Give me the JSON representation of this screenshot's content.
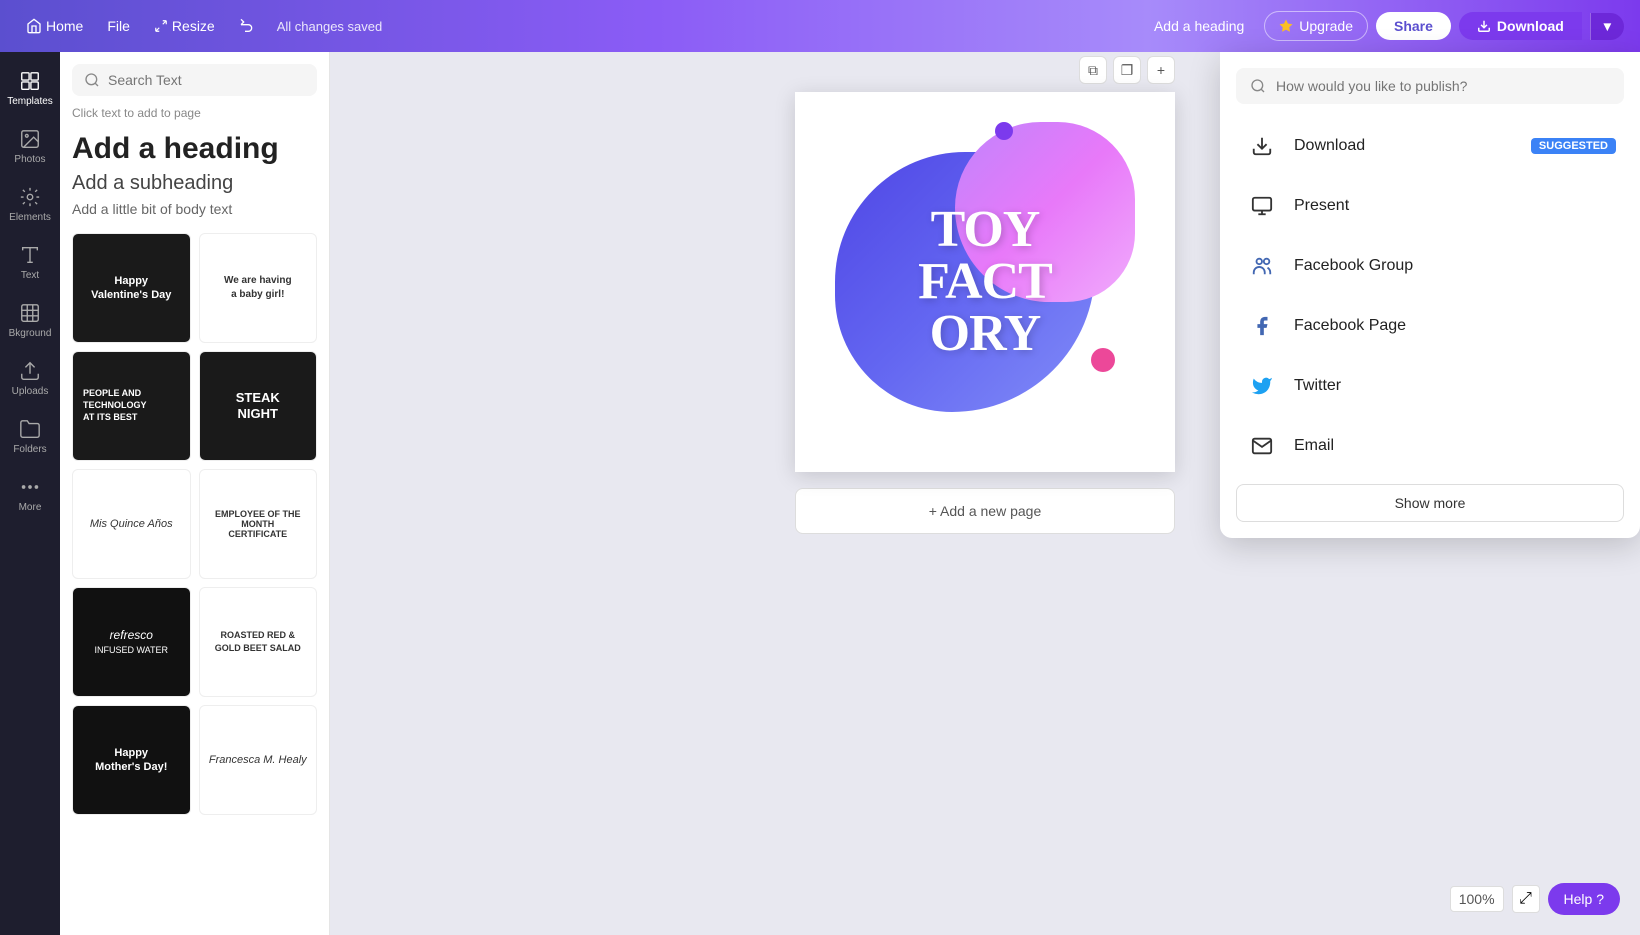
{
  "topnav": {
    "home_label": "Home",
    "file_label": "File",
    "resize_label": "Resize",
    "saved_text": "All changes saved",
    "add_heading_label": "Add a heading",
    "upgrade_label": "Upgrade",
    "share_label": "Share",
    "download_label": "Download"
  },
  "sidebar": {
    "items": [
      {
        "id": "templates",
        "label": "Templates"
      },
      {
        "id": "photos",
        "label": "Photos"
      },
      {
        "id": "elements",
        "label": "Elements"
      },
      {
        "id": "text",
        "label": "Text"
      },
      {
        "id": "background",
        "label": "Bkground"
      },
      {
        "id": "uploads",
        "label": "Uploads"
      },
      {
        "id": "folders",
        "label": "Folders"
      },
      {
        "id": "more",
        "label": "More"
      }
    ]
  },
  "text_panel": {
    "search_placeholder": "Search Text",
    "click_to_add": "Click text to add to page",
    "heading_large": "Add a heading",
    "heading_sub": "Add a subheading",
    "heading_body": "Add a little bit of body text",
    "templates": [
      {
        "id": "valentine",
        "title": "Happy Valentine's Day",
        "style": "dark"
      },
      {
        "id": "baby",
        "title": "We are having a baby girl!",
        "style": "light"
      },
      {
        "id": "tech",
        "title": "PEOPLE AND TECHNOLOGY AT ITS BEST",
        "style": "dark"
      },
      {
        "id": "steak",
        "title": "STEAK NIGHT",
        "style": "dark"
      },
      {
        "id": "quince",
        "title": "Mis Quince Años",
        "style": "light"
      },
      {
        "id": "cert",
        "title": "EMPLOYEE OF THE MONTH CERTIFICATE",
        "style": "light"
      },
      {
        "id": "refresco",
        "title": "refresco INFUSED WATER",
        "style": "dark"
      },
      {
        "id": "salad",
        "title": "ROASTED RED & GOLD BEET SALAD",
        "style": "light"
      },
      {
        "id": "mothers",
        "title": "Happy Mother's Day!",
        "style": "dark"
      },
      {
        "id": "francesca",
        "title": "Francesca M. Healy",
        "style": "light"
      }
    ]
  },
  "canvas": {
    "design_text": "TOY FACTORY",
    "add_page_label": "+ Add a new page",
    "zoom_level": "100%"
  },
  "dropdown": {
    "search_placeholder": "How would you like to publish?",
    "items": [
      {
        "id": "download",
        "label": "Download",
        "icon": "download-icon",
        "suggested": true
      },
      {
        "id": "present",
        "label": "Present",
        "icon": "present-icon",
        "suggested": false
      },
      {
        "id": "facebook-group",
        "label": "Facebook Group",
        "icon": "facebook-group-icon",
        "suggested": false
      },
      {
        "id": "facebook-page",
        "label": "Facebook Page",
        "icon": "facebook-page-icon",
        "suggested": false
      },
      {
        "id": "twitter",
        "label": "Twitter",
        "icon": "twitter-icon",
        "suggested": false
      },
      {
        "id": "email",
        "label": "Email",
        "icon": "email-icon",
        "suggested": false
      }
    ],
    "show_more_label": "Show more",
    "suggested_label": "SUGGESTED"
  },
  "help": {
    "label": "Help ?"
  }
}
